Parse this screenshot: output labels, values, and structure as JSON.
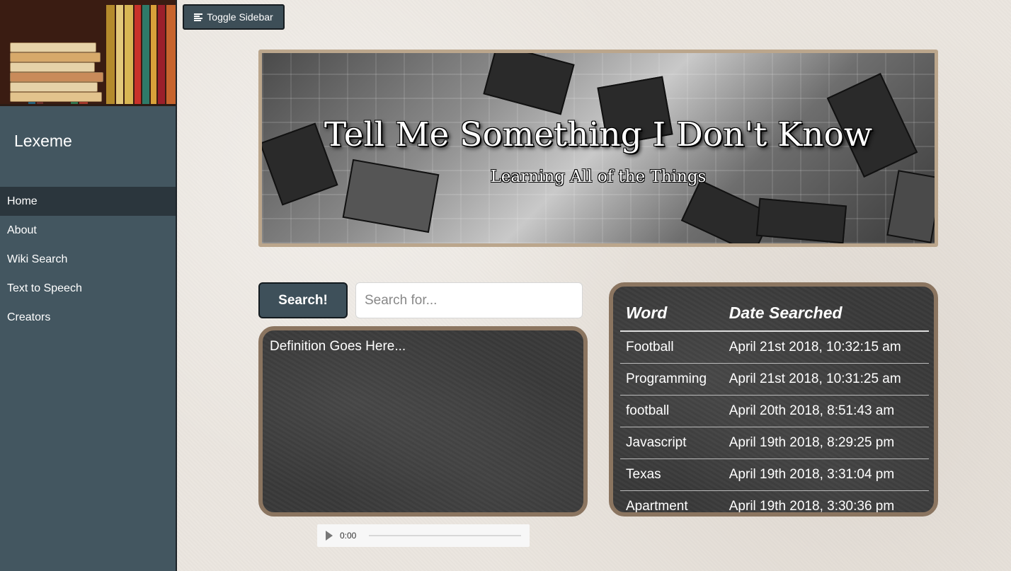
{
  "sidebar": {
    "brand": "Lexeme",
    "items": [
      {
        "label": "Home",
        "active": true
      },
      {
        "label": "About"
      },
      {
        "label": "Wiki Search"
      },
      {
        "label": "Text to Speech"
      },
      {
        "label": "Creators"
      }
    ]
  },
  "toolbar": {
    "toggle_label": "Toggle Sidebar",
    "toggle_icon": "menu-icon"
  },
  "hero": {
    "title": "Tell Me Something I Don't Know",
    "subtitle": "Learning All of the Things"
  },
  "search": {
    "button_label": "Search!",
    "placeholder": "Search for...",
    "value": ""
  },
  "definition": {
    "text": "Definition Goes Here..."
  },
  "audio": {
    "time": "0:00"
  },
  "history": {
    "columns": [
      "Word",
      "Date Searched"
    ],
    "rows": [
      {
        "word": "Football",
        "date": "April 21st 2018, 10:32:15 am"
      },
      {
        "word": "Programming",
        "date": "April 21st 2018, 10:31:25 am"
      },
      {
        "word": "football",
        "date": "April 20th 2018, 8:51:43 am"
      },
      {
        "word": "Javascript",
        "date": "April 19th 2018, 8:29:25 pm"
      },
      {
        "word": "Texas",
        "date": "April 19th 2018, 3:31:04 pm"
      },
      {
        "word": "Apartment",
        "date": "April 19th 2018, 3:30:36 pm"
      }
    ]
  },
  "colors": {
    "sidebar": "#435660",
    "active_nav": "#2b363d",
    "frame": "#8b7560",
    "chalkboard": "#3a3a3a"
  }
}
